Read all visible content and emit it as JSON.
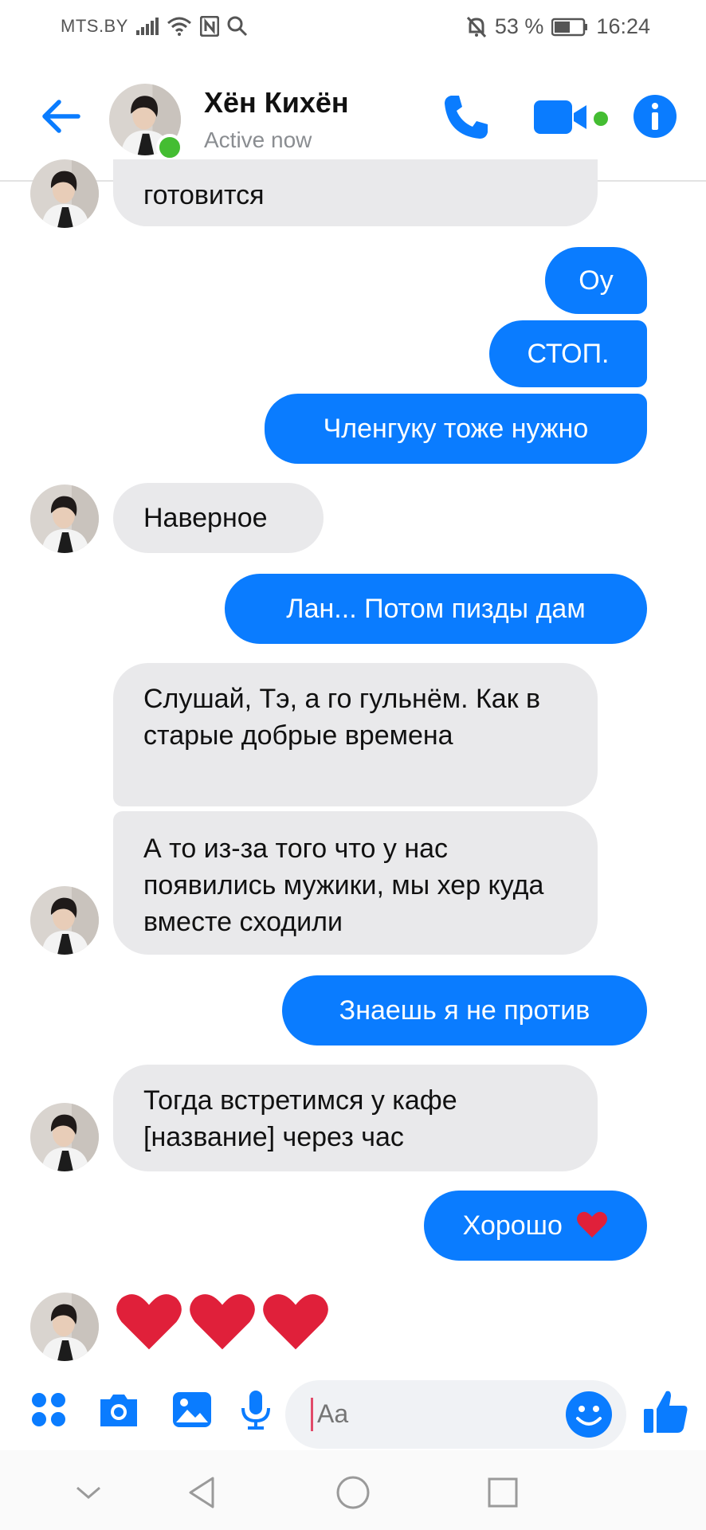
{
  "status_bar": {
    "carrier": "MTS.BY",
    "battery": "53 %",
    "time": "16:24"
  },
  "header": {
    "contact_name": "Хён Кихён",
    "status": "Active now",
    "accent_color": "#0a7cff",
    "online_color": "#44bd32"
  },
  "messages": [
    {
      "side": "in",
      "text": "готовится"
    },
    {
      "side": "out",
      "text": "Оу"
    },
    {
      "side": "out",
      "text": "СТОП."
    },
    {
      "side": "out",
      "text": "Членгуку тоже нужно"
    },
    {
      "side": "in",
      "text": "Наверное"
    },
    {
      "side": "out",
      "text": "Лан... Потом пизды дам"
    },
    {
      "side": "in",
      "text": "Слушай, Тэ, а го гульнём. Как в старые добрые времена"
    },
    {
      "side": "in",
      "text": "А то из-за того что у нас появились мужики, мы хер куда вместе сходили"
    },
    {
      "side": "out",
      "text": "Знаешь  я не против"
    },
    {
      "side": "in",
      "text": "Тогда встретимся у кафе [название] через час"
    },
    {
      "side": "out",
      "text": "Хорошо",
      "emoji": "red-heart"
    },
    {
      "side": "in",
      "emoji_only": [
        "red-heart",
        "red-heart",
        "red-heart"
      ]
    }
  ],
  "composer": {
    "placeholder": "Aa",
    "icons": [
      "apps-icon",
      "camera-icon",
      "gallery-icon",
      "microphone-icon",
      "emoji-icon",
      "thumbs-up-icon"
    ]
  },
  "nav_bar": {
    "icons": [
      "chevron-down-icon",
      "back-triangle-icon",
      "home-circle-icon",
      "recents-square-icon"
    ]
  }
}
